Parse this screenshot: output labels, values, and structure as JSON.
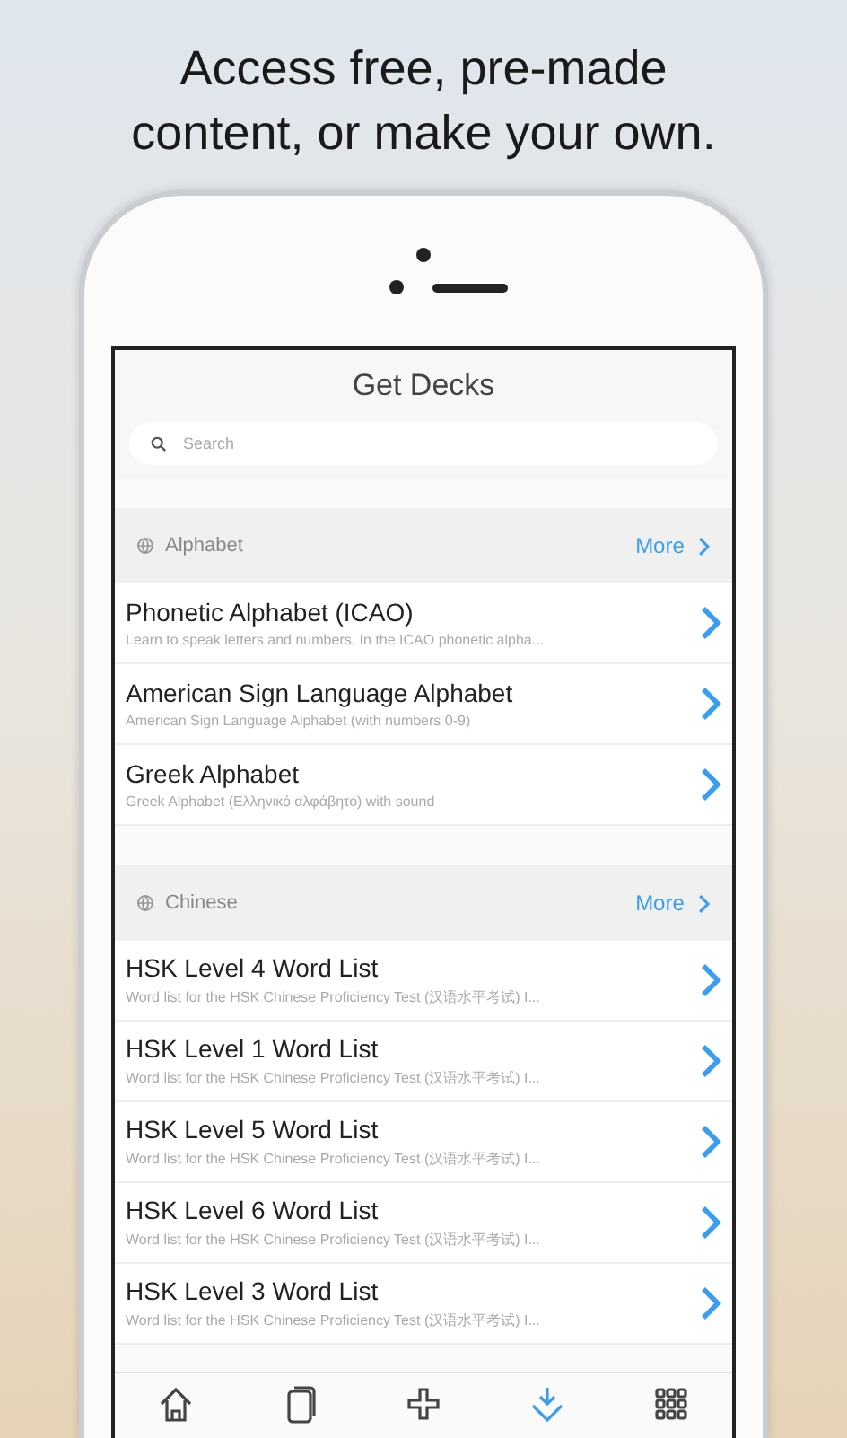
{
  "headline": "Access free, pre-made content, or make your own.",
  "screen": {
    "title": "Get Decks",
    "search": {
      "placeholder": "Search"
    },
    "sections": [
      {
        "name": "Alphabet",
        "more": "More",
        "decks": [
          {
            "title": "Phonetic Alphabet (ICAO)",
            "description": "Learn to speak letters and numbers. In the ICAO phonetic alpha..."
          },
          {
            "title": "American Sign Language Alphabet",
            "description": "American Sign Language Alphabet (with numbers 0-9)"
          },
          {
            "title": "Greek Alphabet",
            "description": "Greek Alphabet (Ελληνικό αλφάβητο) with sound"
          }
        ]
      },
      {
        "name": "Chinese",
        "more": "More",
        "decks": [
          {
            "title": "HSK Level 4 Word List",
            "description": "Word list for the HSK Chinese Proficiency Test (汉语水平考试) I..."
          },
          {
            "title": "HSK Level 1 Word List",
            "description": "Word list for the HSK Chinese Proficiency Test (汉语水平考试) I..."
          },
          {
            "title": "HSK Level 5 Word List",
            "description": "Word list for the HSK Chinese Proficiency Test (汉语水平考试) I..."
          },
          {
            "title": "HSK Level 6 Word List",
            "description": "Word list for the HSK Chinese Proficiency Test (汉语水平考试) I..."
          },
          {
            "title": "HSK Level 3 Word List",
            "description": "Word list for the HSK Chinese Proficiency Test (汉语水平考试) I..."
          }
        ]
      }
    ],
    "tabs": [
      {
        "kind": "home",
        "selected": false
      },
      {
        "kind": "cards",
        "selected": false
      },
      {
        "kind": "add",
        "selected": false
      },
      {
        "kind": "download",
        "selected": true
      },
      {
        "kind": "grid",
        "selected": false
      }
    ]
  }
}
